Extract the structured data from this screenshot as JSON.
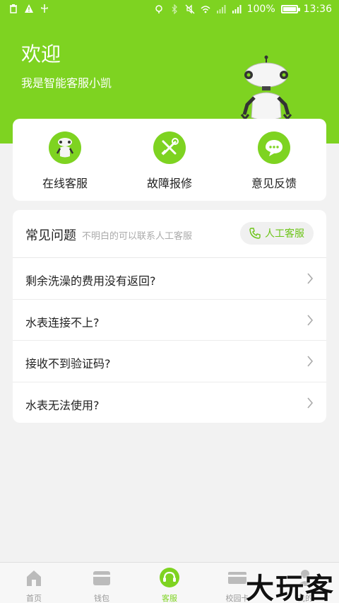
{
  "status_bar": {
    "battery_pct": "100%",
    "time": "13:36"
  },
  "hero": {
    "welcome": "欢迎",
    "subtitle": "我是智能客服小凯"
  },
  "services": [
    {
      "label": "在线客服",
      "icon": "robot-icon"
    },
    {
      "label": "故障报修",
      "icon": "tools-icon"
    },
    {
      "label": "意见反馈",
      "icon": "chat-bubble-icon"
    }
  ],
  "faq": {
    "title": "常见问题",
    "hint": "不明白的可以联系人工客服",
    "human_button": "人工客服",
    "items": [
      "剩余洗澡的费用没有返回?",
      "水表连接不上?",
      "接收不到验证码?",
      "水表无法使用?"
    ]
  },
  "tabbar": {
    "tabs": [
      {
        "label": "首页",
        "icon": "home-icon"
      },
      {
        "label": "钱包",
        "icon": "wallet-icon"
      },
      {
        "label": "客服",
        "icon": "headset-icon"
      },
      {
        "label": "校园卡",
        "icon": "card-icon"
      },
      {
        "label": "我的",
        "icon": "user-icon"
      }
    ],
    "active_index": 2
  },
  "watermark": "大玩客",
  "colors": {
    "accent": "#7ed321",
    "background": "#f2f2f2"
  }
}
